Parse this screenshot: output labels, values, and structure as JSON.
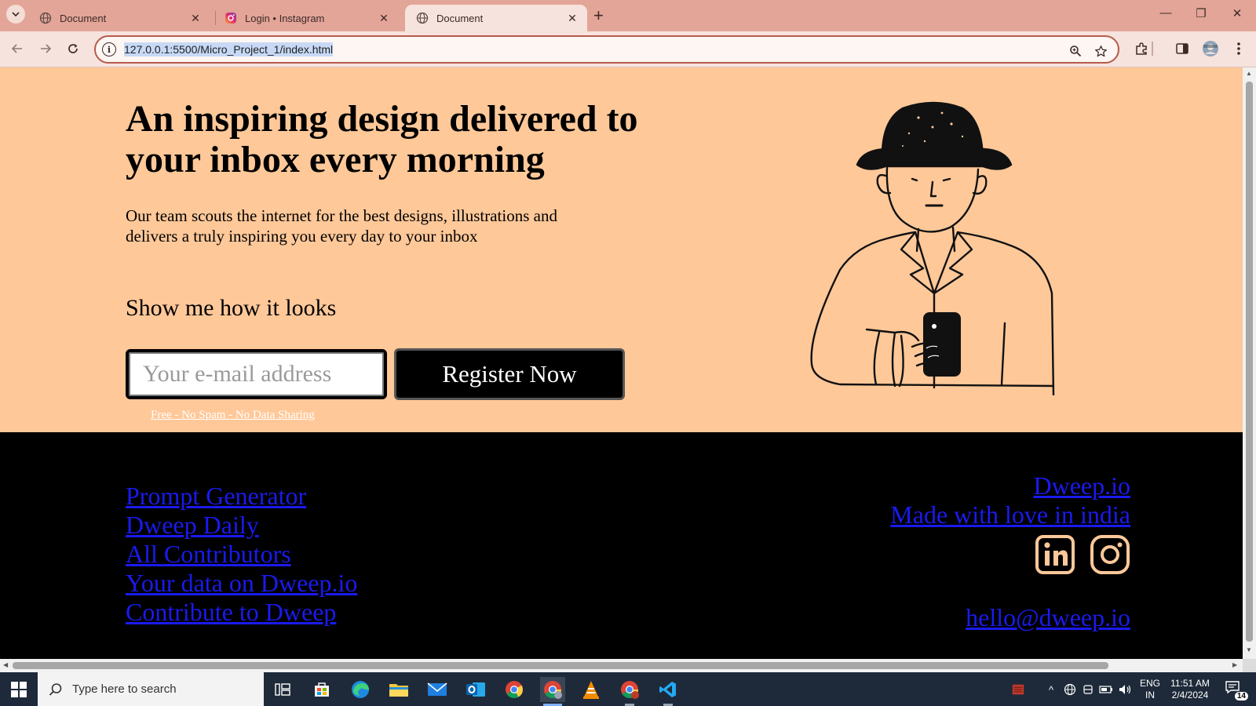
{
  "browser": {
    "tabs": [
      {
        "title": "Document",
        "active": false
      },
      {
        "title": "Login • Instagram",
        "active": false
      },
      {
        "title": "Document",
        "active": true
      }
    ],
    "url": "127.0.0.1:5500/Micro_Project_1/index.html",
    "colors": {
      "tabstrip": "#e3a598",
      "toolbar": "#f6e3dd",
      "omnibox_border": "#b85a4a"
    }
  },
  "page": {
    "headline": "An inspiring design delivered to your inbox every morning",
    "description": "Our team scouts the internet for the best designs, illustrations and delivers a truly inspiring you every day to your inbox",
    "subheading": "Show me how it looks",
    "email_placeholder": "Your e-mail address",
    "register_label": "Register Now",
    "fine_print": "Free - No Spam - No Data Sharing",
    "illustration": "man-with-hat-holding-phone",
    "colors": {
      "hero_bg": "#ffc899",
      "footer_bg": "#000000",
      "link": "#1a1aee"
    }
  },
  "footer": {
    "links": [
      "Prompt Generator",
      "Dweep Daily",
      "All Contributors",
      "Your data on Dweep.io",
      "Contribute to Dweep"
    ],
    "brand": "Dweep.io",
    "tagline": "Made with love in india",
    "social": [
      "linkedin-icon",
      "instagram-icon"
    ],
    "email": "hello@dweep.io"
  },
  "taskbar": {
    "search_placeholder": "Type here to search",
    "lang_line1": "ENG",
    "lang_line2": "IN",
    "time": "11:51 AM",
    "date": "2/4/2024",
    "notification_count": "14"
  }
}
